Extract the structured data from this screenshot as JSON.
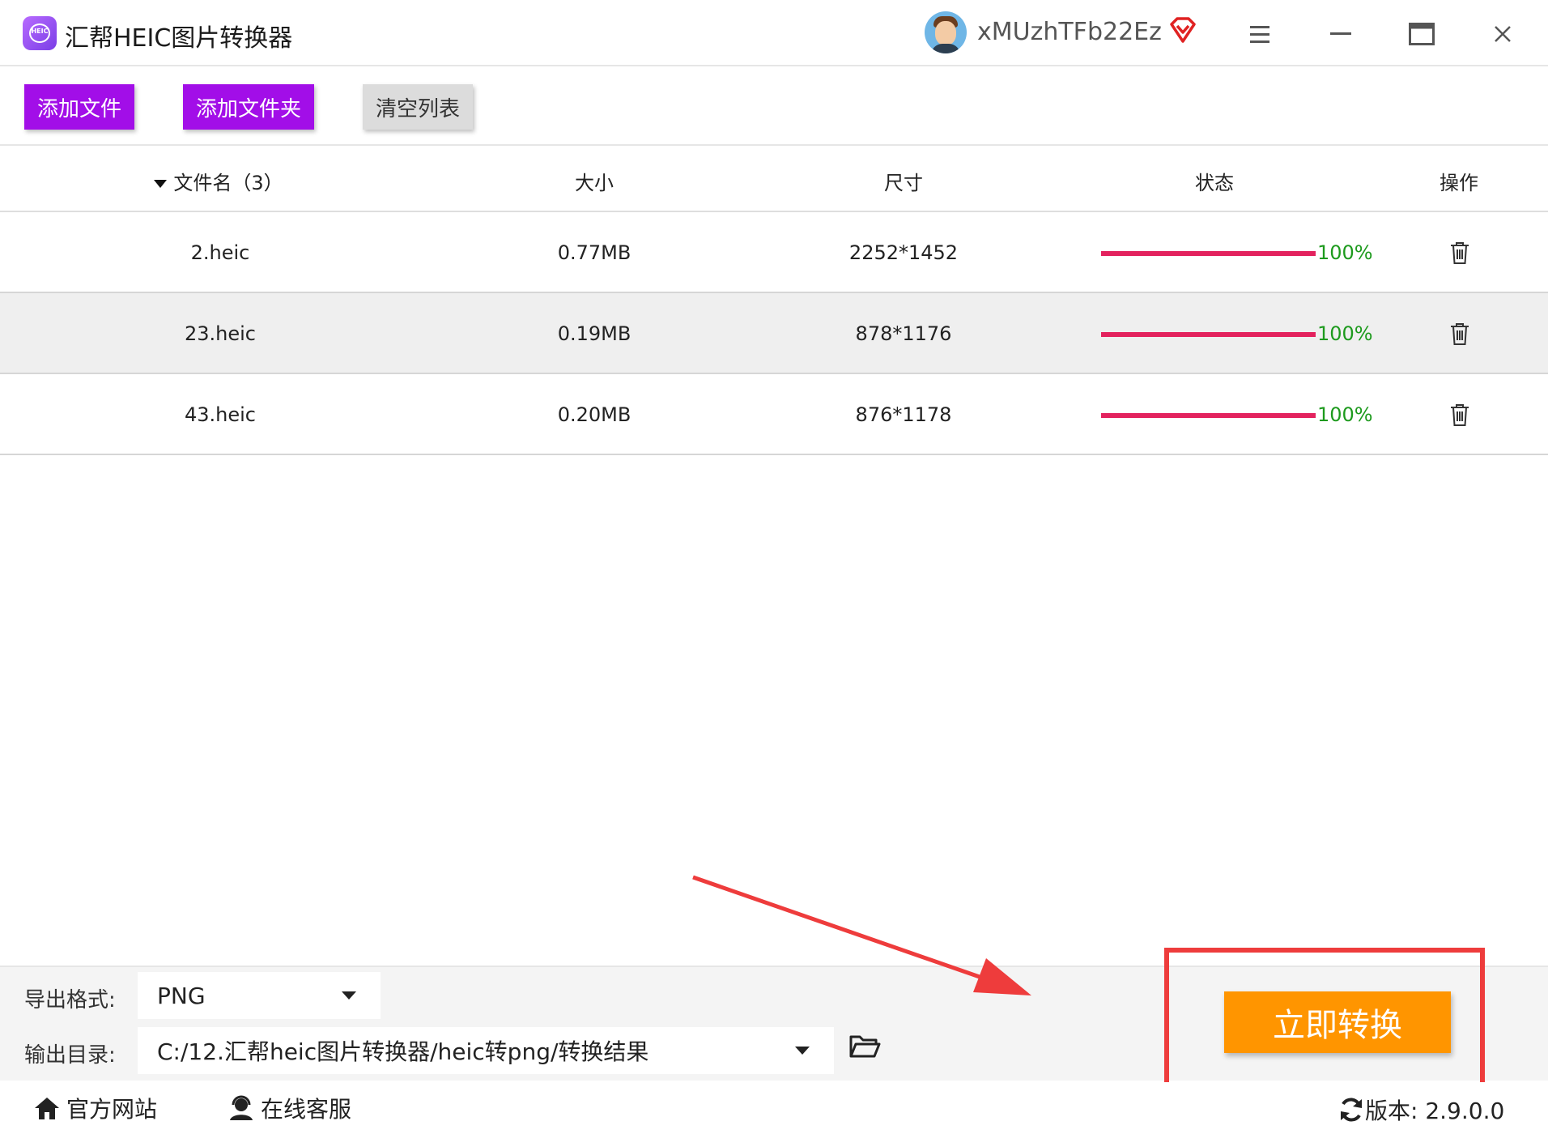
{
  "app": {
    "title": "汇帮HEIC图片转换器",
    "username": "xMUzhTFb22Ez",
    "logo_text": "HEIC"
  },
  "toolbar": {
    "add_file": "添加文件",
    "add_folder": "添加文件夹",
    "clear_list": "清空列表"
  },
  "table": {
    "headers": {
      "name": "文件名（3）",
      "size": "大小",
      "dimension": "尺寸",
      "status": "状态",
      "action": "操作"
    },
    "rows": [
      {
        "name": "2.heic",
        "size": "0.77MB",
        "dimension": "2252*1452",
        "progress": 1.0,
        "status": "100%"
      },
      {
        "name": "23.heic",
        "size": "0.19MB",
        "dimension": "878*1176",
        "progress": 1.0,
        "status": "100%"
      },
      {
        "name": "43.heic",
        "size": "0.20MB",
        "dimension": "876*1178",
        "progress": 1.0,
        "status": "100%"
      }
    ]
  },
  "export": {
    "format_label": "导出格式:",
    "format_value": "PNG",
    "dir_label": "输出目录:",
    "dir_value": "C:/12.汇帮heic图片转换器/heic转png/转换结果"
  },
  "convert_button": "立即转换",
  "footer": {
    "website": "官方网站",
    "support": "在线客服",
    "version": "版本: 2.9.0.0"
  },
  "colors": {
    "primary_purple": "#a20ee8",
    "convert_orange": "#ff9500",
    "progress_red": "#e3225e",
    "status_green": "#1d9a1d",
    "annotation_red": "#ee3c3c"
  }
}
